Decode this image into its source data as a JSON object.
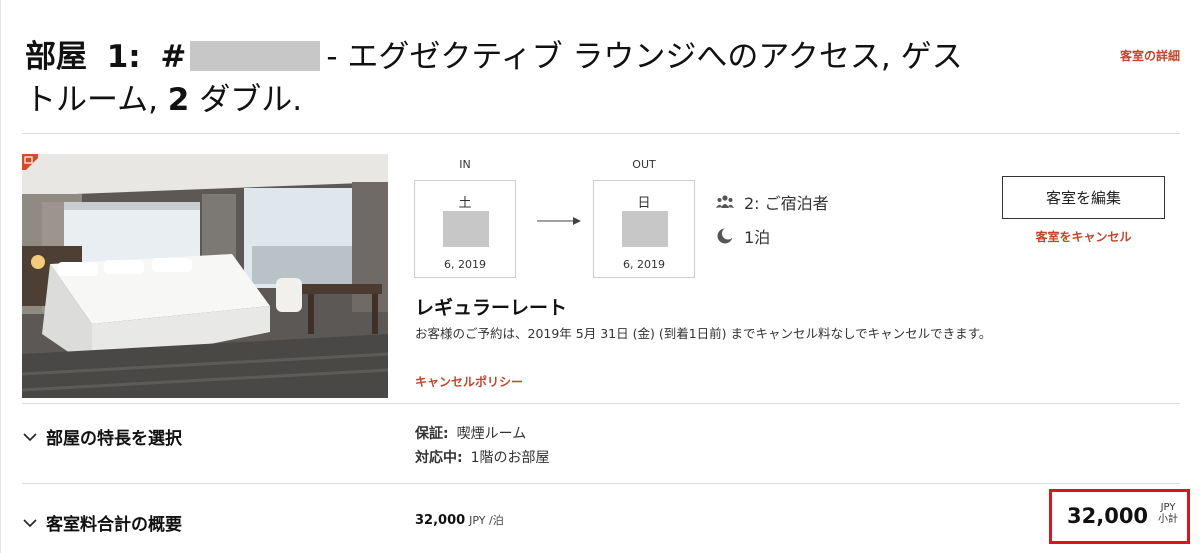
{
  "header": {
    "room_prefix": "部屋",
    "room_number": "1:",
    "hash": "#",
    "room_name_line1": "- エグゼクティブ ラウンジへのアクセス, ゲス",
    "room_name_line2_a": "トルーム, ",
    "room_name_line2_b": "2",
    "room_name_line2_c": " ダブル.",
    "details_link": "客室の詳細"
  },
  "stay": {
    "checkin_label": "IN",
    "checkin_day": "土",
    "checkin_year": "6, 2019",
    "checkout_label": "OUT",
    "checkout_day": "日",
    "checkout_year": "6, 2019",
    "guests": "2: ご宿泊者",
    "nights": "1泊",
    "guests_icon": "people-icon",
    "nights_icon": "moon-icon"
  },
  "actions": {
    "edit_room": "客室を編集",
    "cancel_room": "客室をキャンセル"
  },
  "rate": {
    "title": "レギュラーレート",
    "description": "お客様のご予約は、2019年 5月 31日 (金) (到着1日前) までキャンセル料なしでキャンセルできます。",
    "policy_link": "キャンセルポリシー"
  },
  "features": {
    "toggle_label": "部屋の特長を選択",
    "guarantee_key": "保証:",
    "guarantee_value": "喫煙ルーム",
    "request_key": "対応中:",
    "request_value": "1階のお部屋"
  },
  "charges": {
    "toggle_label": "客室料合計の概要",
    "nightly_amount": "32,000",
    "nightly_unit": "JPY /泊",
    "subtotal_amount": "32,000",
    "subtotal_currency": "JPY",
    "subtotal_label": "小計"
  },
  "colors": {
    "link": "#c0462c",
    "highlight": "#d7161d",
    "redaction": "#c7c7c7"
  }
}
